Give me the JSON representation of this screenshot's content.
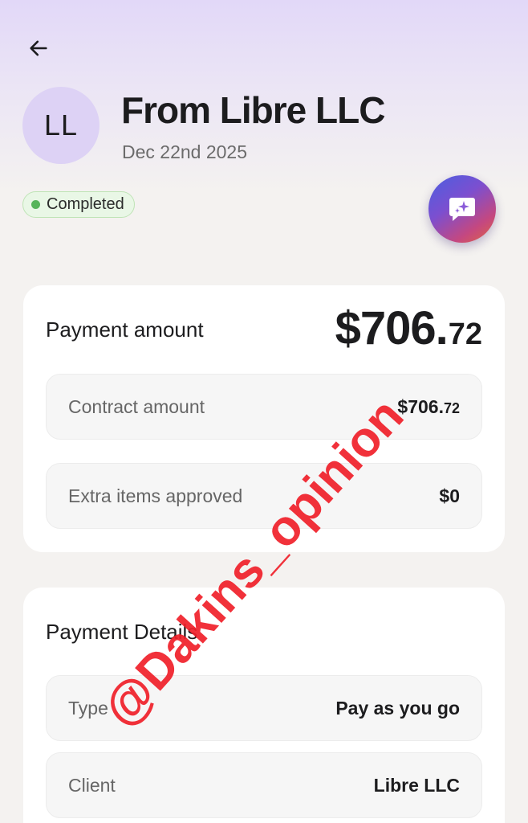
{
  "header": {
    "avatar_initials": "LL",
    "title": "From Libre LLC",
    "date": "Dec 22nd 2025",
    "status": "Completed",
    "icons": {
      "back": "arrow-left-icon",
      "ai": "chat-sparkle-icon"
    }
  },
  "payment_amount": {
    "label": "Payment amount",
    "value_main": "$706.",
    "value_cents": "72",
    "rows": [
      {
        "label": "Contract amount",
        "value_main": "$706.",
        "value_cents": "72"
      },
      {
        "label": "Extra items approved",
        "value_main": "$0",
        "value_cents": ""
      }
    ]
  },
  "payment_details": {
    "title": "Payment Details",
    "rows": [
      {
        "label": "Type",
        "value": "Pay as you go"
      },
      {
        "label": "Client",
        "value": "Libre LLC"
      }
    ]
  },
  "watermark": "@Dakins_opinion",
  "colors": {
    "status_green": "#56b45a",
    "avatar_bg": "#ddd2f5",
    "watermark_red": "#f0202a"
  }
}
